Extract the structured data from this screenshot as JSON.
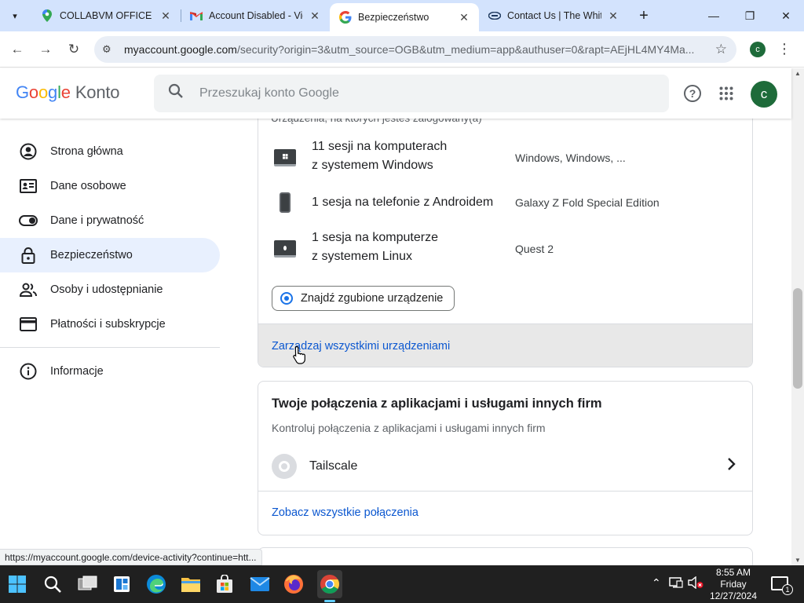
{
  "browser": {
    "tabs": [
      {
        "title": "COLLABVM OFFICE – Map",
        "icon": "maps-pin-icon"
      },
      {
        "title": "Account Disabled - View",
        "icon": "gmail-icon"
      },
      {
        "title": "Bezpieczeństwo",
        "icon": "google-g-icon",
        "active": true
      },
      {
        "title": "Contact Us | The White House",
        "icon": "whitehouse-seal-icon"
      }
    ],
    "new_tab": "+",
    "url_host": "myaccount.google.com",
    "url_rest": "/security?origin=3&utm_source=OGB&utm_medium=app&authuser=0&rapt=AEjHL4MY4Ma...",
    "profile_initial": "c"
  },
  "header": {
    "logo_letters": [
      "G",
      "o",
      "o",
      "g",
      "l",
      "e"
    ],
    "logo_suffix": "Konto",
    "search_placeholder": "Przeszukaj konto Google",
    "avatar_initial": "c"
  },
  "sidebar": {
    "items": [
      {
        "label": "Strona główna",
        "icon": "account-circle-icon"
      },
      {
        "label": "Dane osobowe",
        "icon": "id-card-icon"
      },
      {
        "label": "Dane i prywatność",
        "icon": "toggle-icon"
      },
      {
        "label": "Bezpieczeństwo",
        "icon": "lock-icon",
        "active": true
      },
      {
        "label": "Osoby i udostępnianie",
        "icon": "people-icon"
      },
      {
        "label": "Płatności i subskrypcje",
        "icon": "credit-card-icon"
      },
      {
        "label": "Informacje",
        "icon": "info-icon"
      }
    ]
  },
  "devices_card": {
    "subtitle": "Urządzenia, na których jesteś zalogowany(a)",
    "devices": [
      {
        "name_line1": "11 sesji na komputerach",
        "name_line2": "z systemem Windows",
        "detail": "Windows, Windows, ..."
      },
      {
        "name_line1": "1 sesja na telefonie z Androidem",
        "name_line2": "",
        "detail": "Galaxy Z Fold Special Edition"
      },
      {
        "name_line1": "1 sesja na komputerze",
        "name_line2": "z systemem Linux",
        "detail": "Quest 2"
      }
    ],
    "find_button": "Znajdź zgubione urządzenie",
    "manage_link": "Zarządzaj wszystkimi urządzeniami"
  },
  "connections_card": {
    "title": "Twoje połączenia z aplikacjami i usługami innych firm",
    "subtitle": "Kontroluj połączenia z aplikacjami i usługami innych firm",
    "apps": [
      {
        "name": "Tailscale"
      }
    ],
    "see_all": "Zobacz wszystkie połączenia"
  },
  "status_url": "https://myaccount.google.com/device-activity?continue=htt...",
  "taskbar": {
    "time": "8:55 AM",
    "day": "Friday",
    "date": "12/27/2024",
    "notification_count": "1"
  }
}
